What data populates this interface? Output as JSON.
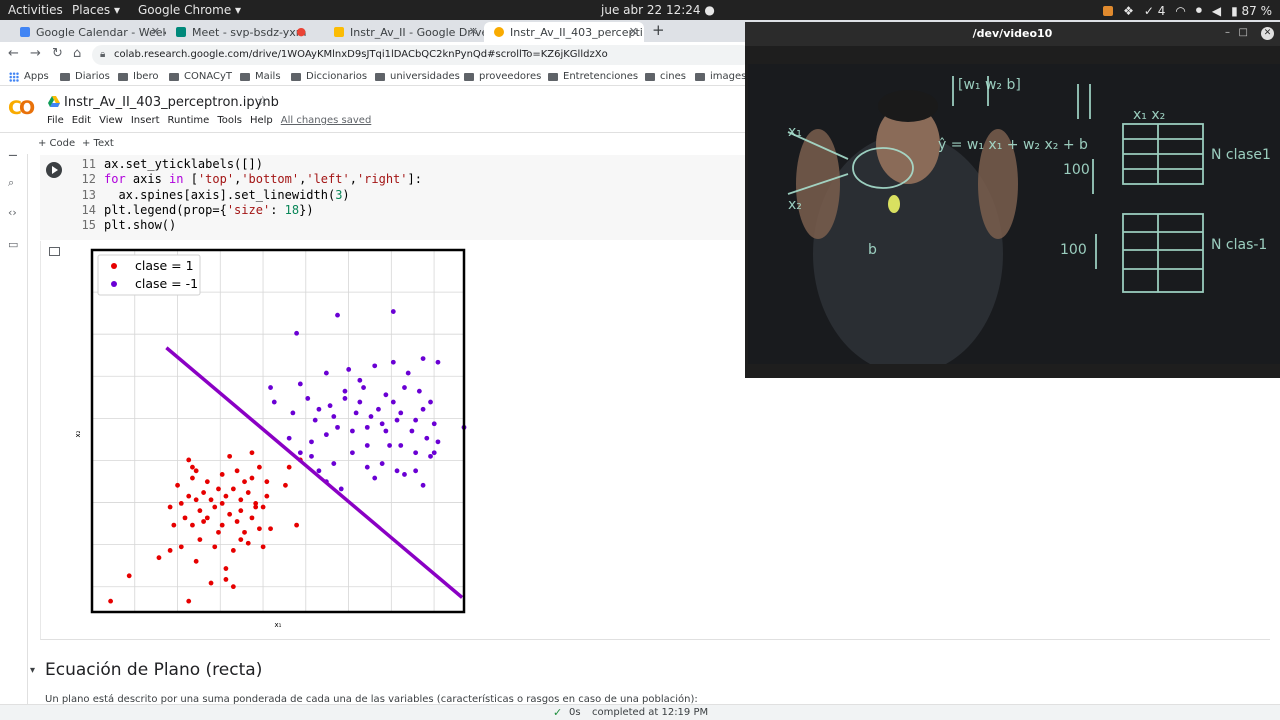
{
  "topbar": {
    "activities": "Activities",
    "places": "Places ▾",
    "chrome": "Google Chrome ▾",
    "clock": "jue abr 22  12:24  ●",
    "tray_count": "4",
    "battery": "87 %"
  },
  "tabs": [
    {
      "label": "Google Calendar - Week o",
      "favicon_color": "#4285f4"
    },
    {
      "label": "Meet - svp-bsdz-yxm",
      "favicon_color": "#00897b"
    },
    {
      "label": "Instr_Av_II - Google Drive",
      "favicon_color": "#fbbc04"
    },
    {
      "label": "Instr_Av_II_403_percepti",
      "favicon_color": "#f9ab00"
    }
  ],
  "address": {
    "url": "colab.research.google.com/drive/1WOAyKMlnxD9sJTqi1lDACbQC2knPynQd#scrollTo=KZ6jKGlldzXo"
  },
  "bookmarks": [
    "Apps",
    "Diarios",
    "Ibero",
    "CONACyT",
    "Mails",
    "Diccionarios",
    "universidades",
    "proveedores",
    "Entretenciones",
    "cines",
    "images"
  ],
  "colab": {
    "title": "Instr_Av_II_403_perceptron.ipynb",
    "menu": [
      "File",
      "Edit",
      "View",
      "Insert",
      "Runtime",
      "Tools",
      "Help"
    ],
    "saved": "All changes saved",
    "add_code": "+ Code",
    "add_text": "+ Text"
  },
  "code": {
    "line_numbers": [
      "11",
      "12",
      "13",
      "14",
      "15"
    ],
    "l11": "ax.set_yticklabels([])",
    "l12_kw": "for",
    "l12_a": " axis ",
    "l12_in": "in",
    "l12_b": " [",
    "l12_s1": "'top'",
    "l12_s2": "'bottom'",
    "l12_s3": "'left'",
    "l12_s4": "'right'",
    "l12_c": "]:",
    "l13_a": "  ax.spines[axis].set_linewidth(",
    "l13_n": "3",
    "l13_b": ")",
    "l14_a": "plt.legend(prop={",
    "l14_s": "'size'",
    "l14_b": ": ",
    "l14_n": "18",
    "l14_c": "})",
    "l15": "plt.show()"
  },
  "chart_data": {
    "type": "scatter",
    "xlabel": "x₁",
    "ylabel": "x₂",
    "xlim": [
      0,
      10
    ],
    "ylim": [
      0,
      10
    ],
    "grid": true,
    "legend_position": "top-left",
    "series": [
      {
        "name": "clase = 1",
        "color": "#e60000",
        "points": [
          [
            0.5,
            0.3
          ],
          [
            1.0,
            1.0
          ],
          [
            2.6,
            0.3
          ],
          [
            2.6,
            4.2
          ],
          [
            2.7,
            4.0
          ],
          [
            3.7,
            4.3
          ],
          [
            4.3,
            4.4
          ],
          [
            4.5,
            4.0
          ],
          [
            1.8,
            1.5
          ],
          [
            2.1,
            1.7
          ],
          [
            2.8,
            1.4
          ],
          [
            3.3,
            1.8
          ],
          [
            3.6,
            1.2
          ],
          [
            3.8,
            1.7
          ],
          [
            4.0,
            2.0
          ],
          [
            4.2,
            1.9
          ],
          [
            4.6,
            1.8
          ],
          [
            2.2,
            2.4
          ],
          [
            2.5,
            2.6
          ],
          [
            2.7,
            2.4
          ],
          [
            2.9,
            2.8
          ],
          [
            3.1,
            2.6
          ],
          [
            3.3,
            2.9
          ],
          [
            3.5,
            2.4
          ],
          [
            3.7,
            2.7
          ],
          [
            3.9,
            2.5
          ],
          [
            4.1,
            2.2
          ],
          [
            4.3,
            2.6
          ],
          [
            4.5,
            2.3
          ],
          [
            4.8,
            2.3
          ],
          [
            2.4,
            3.0
          ],
          [
            2.6,
            3.2
          ],
          [
            2.8,
            3.1
          ],
          [
            3.0,
            3.3
          ],
          [
            3.2,
            3.1
          ],
          [
            3.4,
            3.4
          ],
          [
            3.6,
            3.2
          ],
          [
            3.8,
            3.4
          ],
          [
            4.0,
            3.1
          ],
          [
            4.2,
            3.3
          ],
          [
            4.4,
            3.0
          ],
          [
            4.6,
            2.9
          ],
          [
            2.3,
            3.5
          ],
          [
            2.7,
            3.7
          ],
          [
            3.1,
            3.6
          ],
          [
            3.5,
            3.8
          ],
          [
            3.9,
            3.9
          ],
          [
            4.3,
            3.7
          ],
          [
            4.7,
            3.6
          ],
          [
            5.2,
            3.5
          ],
          [
            2.1,
            2.9
          ],
          [
            2.9,
            2.0
          ],
          [
            3.4,
            2.2
          ],
          [
            4.0,
            2.8
          ],
          [
            4.4,
            2.9
          ],
          [
            5.5,
            2.4
          ],
          [
            5.6,
            4.2
          ],
          [
            5.3,
            4.0
          ],
          [
            3.2,
            0.8
          ],
          [
            3.8,
            0.7
          ],
          [
            2.4,
            1.8
          ],
          [
            3.6,
            0.9
          ],
          [
            4.7,
            3.2
          ],
          [
            3.0,
            2.5
          ],
          [
            3.5,
            3.0
          ],
          [
            2.8,
            3.9
          ],
          [
            4.1,
            3.6
          ]
        ]
      },
      {
        "name": "clase = -1",
        "color": "#6a00d4",
        "points": [
          [
            5.5,
            7.7
          ],
          [
            6.6,
            8.2
          ],
          [
            8.1,
            8.3
          ],
          [
            4.8,
            6.2
          ],
          [
            5.6,
            6.3
          ],
          [
            6.3,
            6.6
          ],
          [
            6.9,
            6.7
          ],
          [
            7.3,
            6.2
          ],
          [
            7.6,
            6.8
          ],
          [
            8.1,
            6.9
          ],
          [
            8.5,
            6.6
          ],
          [
            8.9,
            7.0
          ],
          [
            9.3,
            6.9
          ],
          [
            4.9,
            5.8
          ],
          [
            5.8,
            5.9
          ],
          [
            6.4,
            5.7
          ],
          [
            6.8,
            5.9
          ],
          [
            7.2,
            5.8
          ],
          [
            7.7,
            5.6
          ],
          [
            8.1,
            5.8
          ],
          [
            8.4,
            6.2
          ],
          [
            8.8,
            6.1
          ],
          [
            9.1,
            5.8
          ],
          [
            5.3,
            4.8
          ],
          [
            5.9,
            4.7
          ],
          [
            6.3,
            4.9
          ],
          [
            6.6,
            5.1
          ],
          [
            7.0,
            5.0
          ],
          [
            7.4,
            5.1
          ],
          [
            7.8,
            5.2
          ],
          [
            8.2,
            5.3
          ],
          [
            8.6,
            5.0
          ],
          [
            9.0,
            4.8
          ],
          [
            9.3,
            4.7
          ],
          [
            6.0,
            5.3
          ],
          [
            6.5,
            5.4
          ],
          [
            7.1,
            5.5
          ],
          [
            7.5,
            5.4
          ],
          [
            7.9,
            5.0
          ],
          [
            8.3,
            4.6
          ],
          [
            8.7,
            4.4
          ],
          [
            9.1,
            4.3
          ],
          [
            10.0,
            5.1
          ],
          [
            5.9,
            4.3
          ],
          [
            6.5,
            4.1
          ],
          [
            7.0,
            4.4
          ],
          [
            7.4,
            4.0
          ],
          [
            7.8,
            4.1
          ],
          [
            8.2,
            3.9
          ],
          [
            8.7,
            3.9
          ],
          [
            9.2,
            4.4
          ],
          [
            5.6,
            4.4
          ],
          [
            6.1,
            3.9
          ],
          [
            6.3,
            3.6
          ],
          [
            6.7,
            3.4
          ],
          [
            7.6,
            3.7
          ],
          [
            8.4,
            3.8
          ],
          [
            8.9,
            3.5
          ],
          [
            6.8,
            6.1
          ],
          [
            7.2,
            6.4
          ],
          [
            7.9,
            6.0
          ],
          [
            8.3,
            5.5
          ],
          [
            8.9,
            5.6
          ],
          [
            9.2,
            5.2
          ],
          [
            7.4,
            4.6
          ],
          [
            6.1,
            5.6
          ],
          [
            5.4,
            5.5
          ],
          [
            8.0,
            4.6
          ],
          [
            8.7,
            5.3
          ]
        ]
      }
    ],
    "decision_line": {
      "x1": 2.0,
      "y1": 7.3,
      "x2": 9.95,
      "y2": 0.4,
      "color": "#8a00c4"
    }
  },
  "webcam": {
    "title": "/dev/video10"
  },
  "section": {
    "heading": "Ecuación de Plano (recta)",
    "text": "Un plano está descrito por una suma ponderada de cada una de las variables (características o rasgos en caso de una población):"
  },
  "status": {
    "time": "0s",
    "completed": "completed at 12:19 PM"
  }
}
